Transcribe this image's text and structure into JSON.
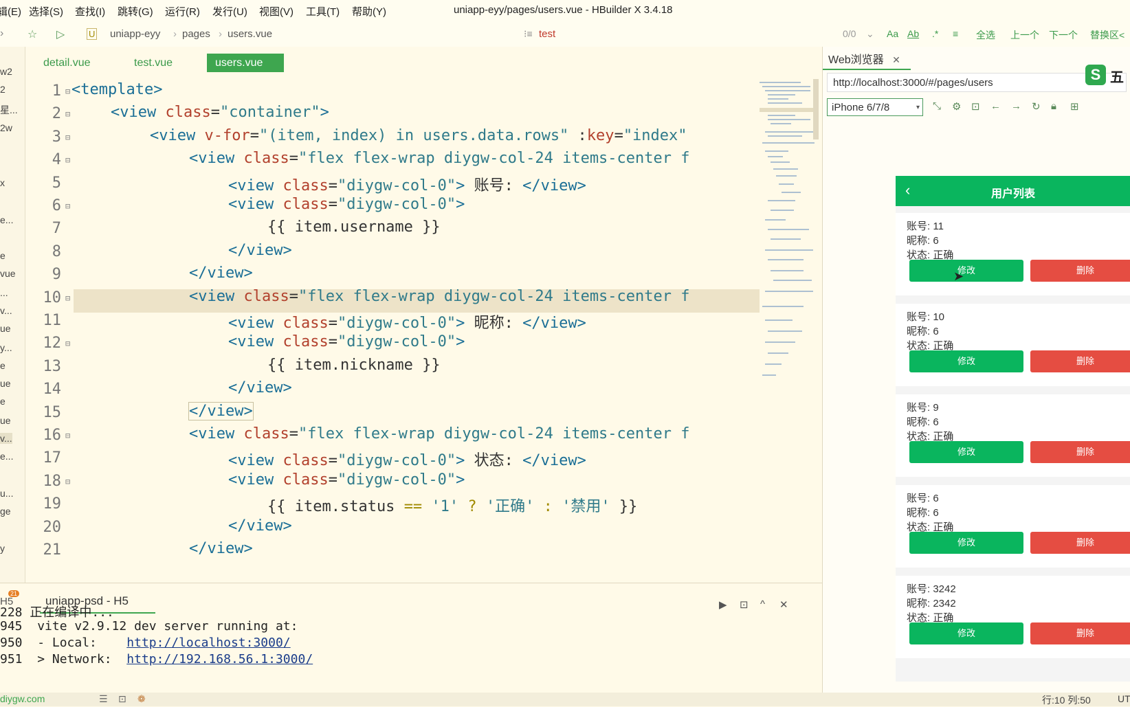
{
  "menu": [
    "辑(E)",
    "选择(S)",
    "查找(I)",
    "跳转(G)",
    "运行(R)",
    "发行(U)",
    "视图(V)",
    "工具(T)",
    "帮助(Y)"
  ],
  "window_title": "uniapp-eyy/pages/users.vue - HBuilder X 3.4.18",
  "breadcrumb": [
    "uniapp-eyy",
    "pages",
    "users.vue"
  ],
  "find": {
    "query": "test",
    "count": "0/0",
    "select_all": "全选",
    "prev": "上一个",
    "next": "下一个",
    "replace": "替换区<"
  },
  "left_panel": [
    "w2",
    "2",
    "星...",
    "2w",
    "x",
    "e...",
    "e",
    "vue",
    "...",
    "v...",
    "ue",
    "y...",
    "e",
    "ue",
    "e",
    "ue",
    "v...",
    "e...",
    "u...",
    "ge",
    "y"
  ],
  "tabs": [
    "detail.vue",
    "test.vue",
    "users.vue"
  ],
  "active_tab": "users.vue",
  "line_numbers": [
    "1",
    "2",
    "3",
    "4",
    "5",
    "6",
    "7",
    "8",
    "9",
    "10",
    "11",
    "12",
    "13",
    "14",
    "15",
    "16",
    "17",
    "18",
    "19",
    "20",
    "21"
  ],
  "code": {
    "l1": "<template>",
    "l2a": "<view ",
    "l2b": "class",
    "l2c": "=",
    "l2d": "\"container\"",
    "l2e": ">",
    "l3a": "<view ",
    "l3b": "v-for",
    "l3c": "=",
    "l3d": "\"(item, index) in users.data.rows\"",
    "l3e": " :",
    "l3f": "key",
    "l3g": "=",
    "l3h": "\"index\"",
    "l4a": "<view ",
    "l4b": "class",
    "l4c": "=",
    "l4d": "\"flex flex-wrap diygw-col-24 items-center f",
    "l5a": "<view ",
    "l5b": "class",
    "l5c": "=",
    "l5d": "\"diygw-col-0\"",
    "l5e": ">",
    "l5f": " 账号: ",
    "l5g": "</view>",
    "l6a": "<view ",
    "l6b": "class",
    "l6c": "=",
    "l6d": "\"diygw-col-0\"",
    "l6e": ">",
    "l7": "{{ item.username }}",
    "l8": "</view>",
    "l9": "</view>",
    "l10a": "<view ",
    "l10b": "class",
    "l10c": "=",
    "l10d": "\"flex flex-wrap diygw-col-24 items-center f",
    "l11a": "<view ",
    "l11b": "class",
    "l11c": "=",
    "l11d": "\"diygw-col-0\"",
    "l11e": ">",
    "l11f": " 昵称: ",
    "l11g": "</view>",
    "l12a": "<view ",
    "l12b": "class",
    "l12c": "=",
    "l12d": "\"diygw-col-0\"",
    "l12e": ">",
    "l13": "{{ item.nickname }}",
    "l14": "</view>",
    "l15": "</view>",
    "l16a": "<view ",
    "l16b": "class",
    "l16c": "=",
    "l16d": "\"flex flex-wrap diygw-col-24 items-center f",
    "l17a": "<view ",
    "l17b": "class",
    "l17c": "=",
    "l17d": "\"diygw-col-0\"",
    "l17e": ">",
    "l17f": " 状态: ",
    "l17g": "</view>",
    "l18a": "<view ",
    "l18b": "class",
    "l18c": "=",
    "l18d": "\"diygw-col-0\"",
    "l18e": ">",
    "l19a": "{{ item.status ",
    "l19b": "==",
    "l19c": " ",
    "l19d": "'1'",
    "l19e": " ? ",
    "l19f": "'正确'",
    "l19g": " : ",
    "l19h": "'禁用'",
    "l19i": " }}",
    "l20": "</view>",
    "l21": "</view>"
  },
  "console": {
    "tab": "uniapp-psd - H5",
    "badge": "21",
    "h5": "H5",
    "lines": [
      {
        "num": "228",
        "text": "正在编译中..."
      },
      {
        "num": "945",
        "text": "  vite v2.9.12 dev server running at:"
      },
      {
        "num": "950",
        "text": "  - Local:    ",
        "link": "http://localhost:3000/"
      },
      {
        "num": "951",
        "text": "  > Network:  ",
        "link": "http://192.168.56.1:3000/"
      }
    ]
  },
  "status": {
    "site": "diygw.com",
    "position": "行:10  列:50",
    "encoding": "UT"
  },
  "browser": {
    "tab": "Web浏览器",
    "url": "http://localhost:3000/#/pages/users",
    "device": "iPhone 6/7/8",
    "ime": "五"
  },
  "phone": {
    "title": "用户列表",
    "users": [
      {
        "account": "账号: 11",
        "nickname": "昵称: 6",
        "status": "状态: 正确",
        "edit": "修改",
        "delete": "删除"
      },
      {
        "account": "账号: 10",
        "nickname": "昵称: 6",
        "status": "状态: 正确",
        "edit": "修改",
        "delete": "删除"
      },
      {
        "account": "账号: 9",
        "nickname": "昵称: 6",
        "status": "状态: 正确",
        "edit": "修改",
        "delete": "删除"
      },
      {
        "account": "账号: 6",
        "nickname": "昵称: 6",
        "status": "状态: 正确",
        "edit": "修改",
        "delete": "删除"
      },
      {
        "account": "账号: 3242",
        "nickname": "昵称: 2342",
        "status": "状态: 正确",
        "edit": "修改",
        "delete": "删除"
      }
    ]
  }
}
